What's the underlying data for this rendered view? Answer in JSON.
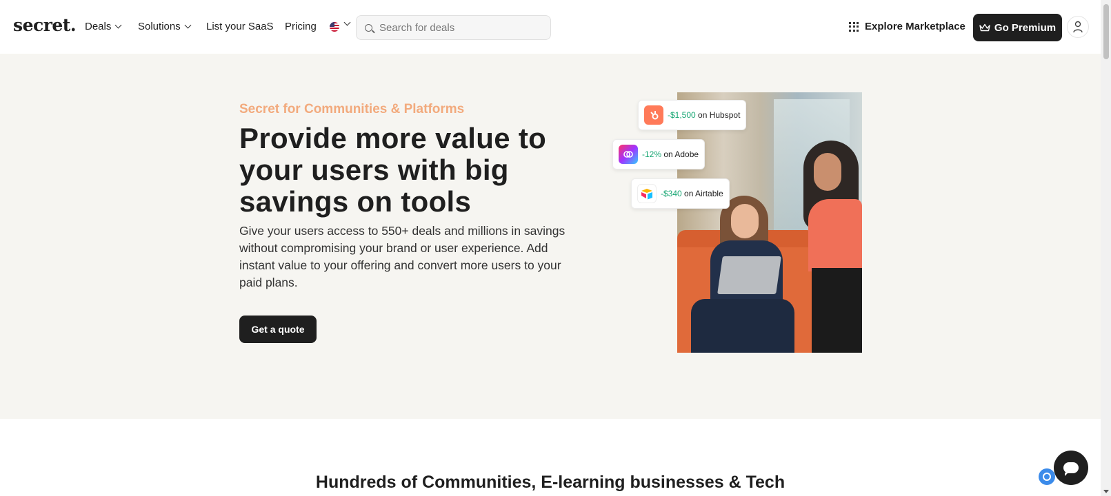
{
  "header": {
    "logo": "secret.",
    "nav": {
      "deals": "Deals",
      "solutions": "Solutions",
      "list_saas": "List your SaaS",
      "pricing": "Pricing"
    },
    "search": {
      "placeholder": "Search for deals",
      "value": ""
    },
    "explore": "Explore Marketplace",
    "premium": "Go Premium"
  },
  "hero": {
    "eyebrow": "Secret for Communities & Platforms",
    "title": "Provide more value to your users with big savings on tools",
    "description": "Give your users access to 550+ deals and millions in savings without compromising your brand or user experience. Add instant value to your offering and convert more users to your paid plans.",
    "cta": "Get a quote"
  },
  "deals": [
    {
      "amount": "-$1,500",
      "suffix": " on Hubspot",
      "logo_icon": "hubspot-icon"
    },
    {
      "amount": "-12%",
      "suffix": " on Adobe",
      "logo_icon": "adobe-icon"
    },
    {
      "amount": "-$340",
      "suffix": " on Airtable",
      "logo_icon": "airtable-icon"
    }
  ],
  "section": {
    "title": "Hundreds of Communities, E-learning businesses & Tech"
  },
  "colors": {
    "accent": "#f2aa7d",
    "dark": "#1f1f1f",
    "hero_bg": "#f6f5f1",
    "savings_green": "#17a673"
  }
}
